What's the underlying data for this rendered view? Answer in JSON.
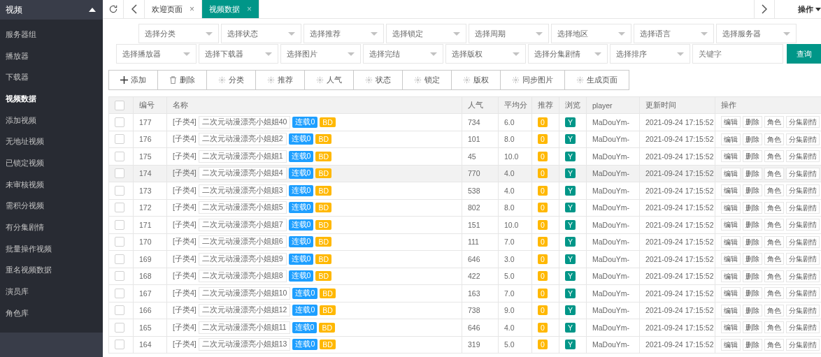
{
  "sidebar": {
    "section": "视频",
    "expanded": true,
    "items": [
      {
        "label": "服务器组",
        "selected": false
      },
      {
        "label": "播放器",
        "selected": false
      },
      {
        "label": "下载器",
        "selected": false
      },
      {
        "label": "视频数据",
        "selected": true
      },
      {
        "label": "添加视频",
        "selected": false
      },
      {
        "label": "无地址视频",
        "selected": false
      },
      {
        "label": "已锁定视频",
        "selected": false
      },
      {
        "label": "未审核视频",
        "selected": false
      },
      {
        "label": "需积分视频",
        "selected": false
      },
      {
        "label": "有分集剧情",
        "selected": false
      },
      {
        "label": "批量操作视频",
        "selected": false
      },
      {
        "label": "重名视频数据",
        "selected": false
      },
      {
        "label": "演员库",
        "selected": false
      },
      {
        "label": "角色库",
        "selected": false
      }
    ]
  },
  "tabs": [
    {
      "label": "欢迎页面",
      "close": "×",
      "selected": false
    },
    {
      "label": "视频数据",
      "close": "×",
      "selected": true
    }
  ],
  "tab_menu": "操作",
  "filters": {
    "row_1": [
      "选择分类",
      "选择状态",
      "选择推荐",
      "选择锁定",
      "选择周期",
      "选择地区",
      "选择语言",
      "选择服务器"
    ],
    "row_2": [
      "选择播放器",
      "选择下载器",
      "选择图片",
      "选择完结",
      "选择版权",
      "选择分集剧情",
      "选择排序"
    ],
    "keyword": {
      "placeholder": "关键字"
    },
    "search_button": "查询"
  },
  "toolbar": [
    {
      "label": "添加",
      "kind": "add"
    },
    {
      "label": "删除",
      "kind": "delete"
    },
    {
      "label": "分类",
      "kind": "gear"
    },
    {
      "label": "推荐",
      "kind": "gear"
    },
    {
      "label": "人气",
      "kind": "gear"
    },
    {
      "label": "状态",
      "kind": "gear"
    },
    {
      "label": "锁定",
      "kind": "gear"
    },
    {
      "label": "版权",
      "kind": "gear"
    },
    {
      "label": "同步图片",
      "kind": "gear"
    },
    {
      "label": "生成页面",
      "kind": "gear"
    }
  ],
  "table": {
    "columns": [
      "编号",
      "名称",
      "人气",
      "平均分",
      "推荐",
      "浏览",
      "player",
      "更新时间",
      "操作"
    ],
    "all_checked": false,
    "rows": [
      {
        "id": "177",
        "category": "[子类4]",
        "name": "二次元动漫漂亮小姐姐40",
        "serial": "连载0",
        "quality": "BD",
        "views": "734",
        "score": "6.0",
        "recommend": "0",
        "browse": "Y",
        "player": "MaDouYm-",
        "updated": "2021-09-24 17:15:52",
        "actions": [
          "编辑",
          "删除",
          "角色",
          "分集剧情"
        ],
        "checked": false,
        "hovered": false
      },
      {
        "id": "176",
        "category": "[子类4]",
        "name": "二次元动漫漂亮小姐姐2",
        "serial": "连载0",
        "quality": "BD",
        "views": "101",
        "score": "8.0",
        "recommend": "0",
        "browse": "Y",
        "player": "MaDouYm-",
        "updated": "2021-09-24 17:15:52",
        "actions": [
          "编辑",
          "删除",
          "角色",
          "分集剧情"
        ],
        "checked": false,
        "hovered": false
      },
      {
        "id": "175",
        "category": "[子类4]",
        "name": "二次元动漫漂亮小姐姐1",
        "serial": "连载0",
        "quality": "BD",
        "views": "45",
        "score": "10.0",
        "recommend": "0",
        "browse": "Y",
        "player": "MaDouYm-",
        "updated": "2021-09-24 17:15:52",
        "actions": [
          "编辑",
          "删除",
          "角色",
          "分集剧情"
        ],
        "checked": false,
        "hovered": false
      },
      {
        "id": "174",
        "category": "[子类4]",
        "name": "二次元动漫漂亮小姐姐4",
        "serial": "连载0",
        "quality": "BD",
        "views": "770",
        "score": "4.0",
        "recommend": "0",
        "browse": "Y",
        "player": "MaDouYm-",
        "updated": "2021-09-24 17:15:52",
        "actions": [
          "编辑",
          "删除",
          "角色",
          "分集剧情"
        ],
        "checked": false,
        "hovered": true
      },
      {
        "id": "173",
        "category": "[子类4]",
        "name": "二次元动漫漂亮小姐姐3",
        "serial": "连载0",
        "quality": "BD",
        "views": "538",
        "score": "4.0",
        "recommend": "0",
        "browse": "Y",
        "player": "MaDouYm-",
        "updated": "2021-09-24 17:15:52",
        "actions": [
          "编辑",
          "删除",
          "角色",
          "分集剧情"
        ],
        "checked": false,
        "hovered": false
      },
      {
        "id": "172",
        "category": "[子类4]",
        "name": "二次元动漫漂亮小姐姐5",
        "serial": "连载0",
        "quality": "BD",
        "views": "802",
        "score": "8.0",
        "recommend": "0",
        "browse": "Y",
        "player": "MaDouYm-",
        "updated": "2021-09-24 17:15:52",
        "actions": [
          "编辑",
          "删除",
          "角色",
          "分集剧情"
        ],
        "checked": false,
        "hovered": false
      },
      {
        "id": "171",
        "category": "[子类4]",
        "name": "二次元动漫漂亮小姐姐7",
        "serial": "连载0",
        "quality": "BD",
        "views": "151",
        "score": "10.0",
        "recommend": "0",
        "browse": "Y",
        "player": "MaDouYm-",
        "updated": "2021-09-24 17:15:52",
        "actions": [
          "编辑",
          "删除",
          "角色",
          "分集剧情"
        ],
        "checked": false,
        "hovered": false
      },
      {
        "id": "170",
        "category": "[子类4]",
        "name": "二次元动漫漂亮小姐姐6",
        "serial": "连载0",
        "quality": "BD",
        "views": "111",
        "score": "7.0",
        "recommend": "0",
        "browse": "Y",
        "player": "MaDouYm-",
        "updated": "2021-09-24 17:15:52",
        "actions": [
          "编辑",
          "删除",
          "角色",
          "分集剧情"
        ],
        "checked": false,
        "hovered": false
      },
      {
        "id": "169",
        "category": "[子类4]",
        "name": "二次元动漫漂亮小姐姐9",
        "serial": "连载0",
        "quality": "BD",
        "views": "646",
        "score": "3.0",
        "recommend": "0",
        "browse": "Y",
        "player": "MaDouYm-",
        "updated": "2021-09-24 17:15:52",
        "actions": [
          "编辑",
          "删除",
          "角色",
          "分集剧情"
        ],
        "checked": false,
        "hovered": false
      },
      {
        "id": "168",
        "category": "[子类4]",
        "name": "二次元动漫漂亮小姐姐8",
        "serial": "连载0",
        "quality": "BD",
        "views": "422",
        "score": "5.0",
        "recommend": "0",
        "browse": "Y",
        "player": "MaDouYm-",
        "updated": "2021-09-24 17:15:52",
        "actions": [
          "编辑",
          "删除",
          "角色",
          "分集剧情"
        ],
        "checked": false,
        "hovered": false
      },
      {
        "id": "167",
        "category": "[子类4]",
        "name": "二次元动漫漂亮小姐姐10",
        "serial": "连载0",
        "quality": "BD",
        "views": "163",
        "score": "7.0",
        "recommend": "0",
        "browse": "Y",
        "player": "MaDouYm-",
        "updated": "2021-09-24 17:15:52",
        "actions": [
          "编辑",
          "删除",
          "角色",
          "分集剧情"
        ],
        "checked": false,
        "hovered": false
      },
      {
        "id": "166",
        "category": "[子类4]",
        "name": "二次元动漫漂亮小姐姐12",
        "serial": "连载0",
        "quality": "BD",
        "views": "738",
        "score": "9.0",
        "recommend": "0",
        "browse": "Y",
        "player": "MaDouYm-",
        "updated": "2021-09-24 17:15:52",
        "actions": [
          "编辑",
          "删除",
          "角色",
          "分集剧情"
        ],
        "checked": false,
        "hovered": false
      },
      {
        "id": "165",
        "category": "[子类4]",
        "name": "二次元动漫漂亮小姐姐11",
        "serial": "连载0",
        "quality": "BD",
        "views": "646",
        "score": "4.0",
        "recommend": "0",
        "browse": "Y",
        "player": "MaDouYm-",
        "updated": "2021-09-24 17:15:52",
        "actions": [
          "编辑",
          "删除",
          "角色",
          "分集剧情"
        ],
        "checked": false,
        "hovered": false
      },
      {
        "id": "164",
        "category": "[子类4]",
        "name": "二次元动漫漂亮小姐姐13",
        "serial": "连载0",
        "quality": "BD",
        "views": "319",
        "score": "5.0",
        "recommend": "0",
        "browse": "Y",
        "player": "MaDouYm-",
        "updated": "2021-09-24 17:15:52",
        "actions": [
          "编辑",
          "删除",
          "角色",
          "分集剧情"
        ],
        "checked": false,
        "hovered": false
      }
    ]
  }
}
